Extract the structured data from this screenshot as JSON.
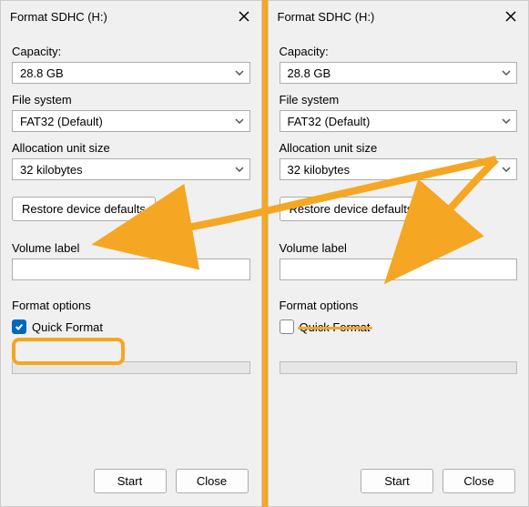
{
  "window_title": "Format SDHC (H:)",
  "labels": {
    "capacity": "Capacity:",
    "file_system": "File system",
    "alloc": "Allocation unit size",
    "volume_label": "Volume label",
    "format_options": "Format options",
    "quick_format": "Quick Format"
  },
  "values": {
    "capacity": "28.8 GB",
    "file_system": "FAT32 (Default)",
    "alloc": "32 kilobytes",
    "volume_label": ""
  },
  "buttons": {
    "restore": "Restore device defaults",
    "start": "Start",
    "close": "Close"
  },
  "quick_format_checked_left": true,
  "quick_format_checked_right": false,
  "annotation_colors": {
    "highlight": "#F5A623"
  }
}
